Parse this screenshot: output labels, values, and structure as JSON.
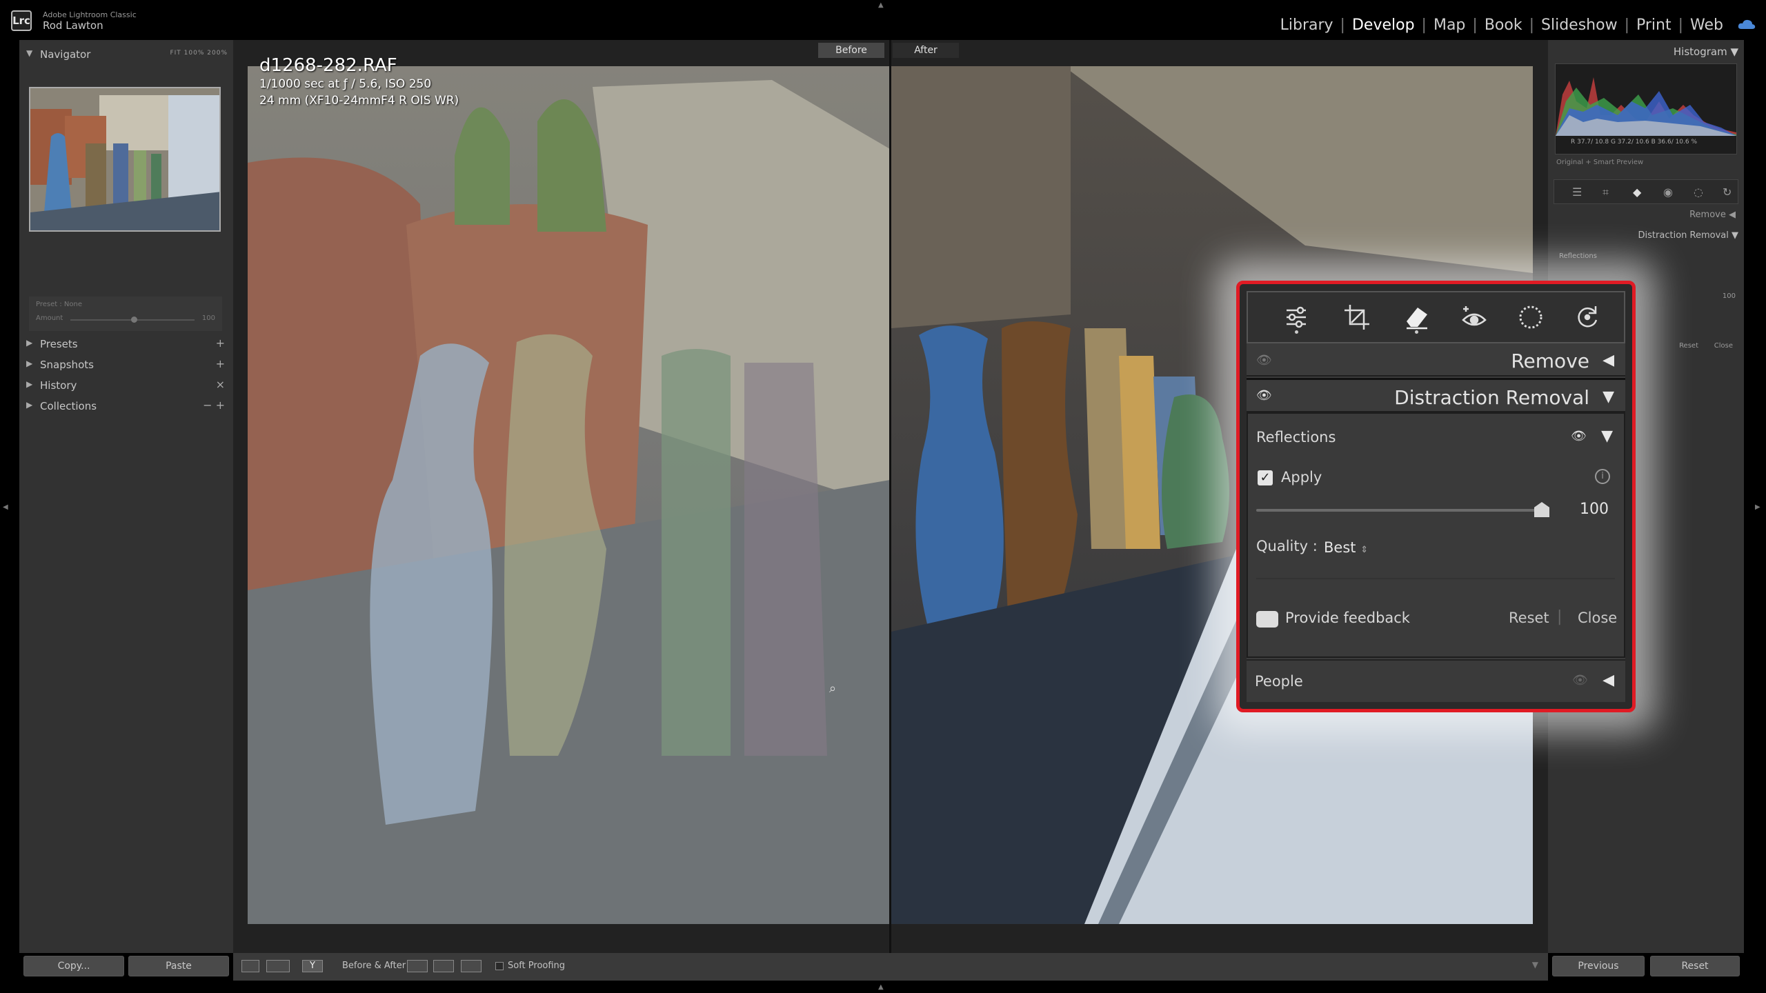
{
  "app": {
    "name": "Adobe Lightroom Classic",
    "user": "Rod Lawton",
    "logo": "Lrc"
  },
  "modules": [
    "Library",
    "Develop",
    "Map",
    "Book",
    "Slideshow",
    "Print",
    "Web"
  ],
  "active_module": "Develop",
  "left_panel": {
    "navigator": {
      "title": "Navigator",
      "zoom_options": [
        "FIT",
        "100%",
        "200%"
      ]
    },
    "preset_amount": {
      "preset_label": "Preset : None",
      "amount_label": "Amount",
      "amount_value": "100"
    },
    "sections": [
      {
        "label": "Presets",
        "action": "+"
      },
      {
        "label": "Snapshots",
        "action": "+"
      },
      {
        "label": "History",
        "action": "×"
      },
      {
        "label": "Collections",
        "action": "− +"
      }
    ],
    "copy_label": "Copy...",
    "paste_label": "Paste"
  },
  "center": {
    "before_label": "Before",
    "after_label": "After",
    "file_name": "d1268-282.RAF",
    "exposure": "1/1000 sec at ƒ / 5.6, ISO 250",
    "lens": "24 mm (XF10-24mmF4 R OIS WR)"
  },
  "toolbar": {
    "before_after_label": "Before & After :",
    "soft_proofing_label": "Soft Proofing"
  },
  "right_panel": {
    "histogram_title": "Histogram",
    "histogram_readout": "R 37.7/ 10.8  G 37.2/ 10.6  B 36.6/ 10.6 %",
    "preview_label": "Original + Smart Preview",
    "remove_label": "Remove",
    "distraction_label": "Distraction Removal",
    "reflections_label": "Reflections",
    "amount_value": "100",
    "reset_label": "Reset",
    "close_label": "Close",
    "previous_label": "Previous",
    "reset_btn_label": "Reset"
  },
  "overlay": {
    "remove_label": "Remove",
    "distraction_label": "Distraction Removal",
    "reflections_label": "Reflections",
    "apply_label": "Apply",
    "apply_checked": true,
    "amount_value": "100",
    "amount_fraction": 1.0,
    "quality_label": "Quality :",
    "quality_value": "Best",
    "feedback_label": "Provide feedback",
    "reset_label": "Reset",
    "close_label": "Close",
    "people_label": "People"
  },
  "colors": {
    "highlight_border": "#e01b24",
    "panel_bg": "#323232",
    "text": "#e3e3e3"
  }
}
